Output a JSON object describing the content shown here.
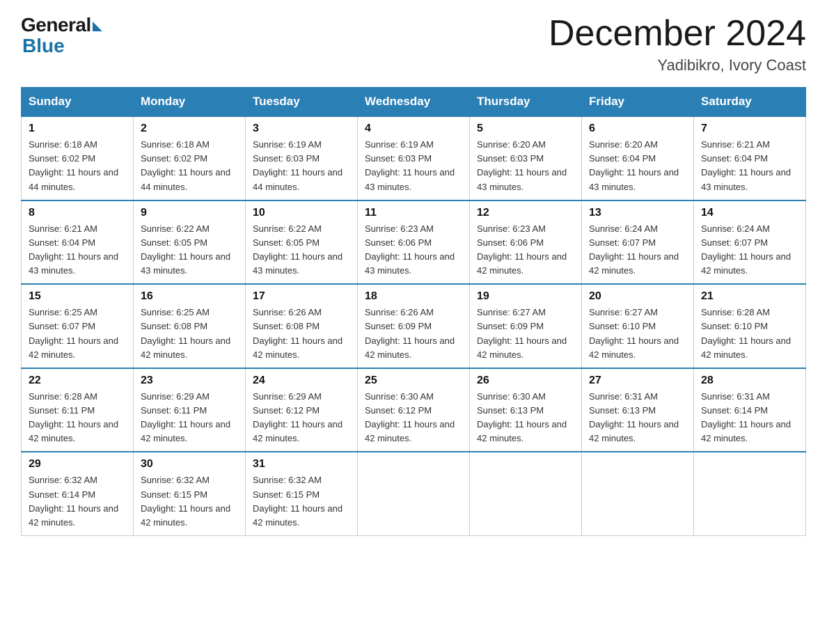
{
  "logo": {
    "general": "General",
    "blue": "Blue"
  },
  "title": "December 2024",
  "location": "Yadibikro, Ivory Coast",
  "days_of_week": [
    "Sunday",
    "Monday",
    "Tuesday",
    "Wednesday",
    "Thursday",
    "Friday",
    "Saturday"
  ],
  "weeks": [
    [
      {
        "day": "1",
        "sunrise": "6:18 AM",
        "sunset": "6:02 PM",
        "daylight": "11 hours and 44 minutes."
      },
      {
        "day": "2",
        "sunrise": "6:18 AM",
        "sunset": "6:02 PM",
        "daylight": "11 hours and 44 minutes."
      },
      {
        "day": "3",
        "sunrise": "6:19 AM",
        "sunset": "6:03 PM",
        "daylight": "11 hours and 44 minutes."
      },
      {
        "day": "4",
        "sunrise": "6:19 AM",
        "sunset": "6:03 PM",
        "daylight": "11 hours and 43 minutes."
      },
      {
        "day": "5",
        "sunrise": "6:20 AM",
        "sunset": "6:03 PM",
        "daylight": "11 hours and 43 minutes."
      },
      {
        "day": "6",
        "sunrise": "6:20 AM",
        "sunset": "6:04 PM",
        "daylight": "11 hours and 43 minutes."
      },
      {
        "day": "7",
        "sunrise": "6:21 AM",
        "sunset": "6:04 PM",
        "daylight": "11 hours and 43 minutes."
      }
    ],
    [
      {
        "day": "8",
        "sunrise": "6:21 AM",
        "sunset": "6:04 PM",
        "daylight": "11 hours and 43 minutes."
      },
      {
        "day": "9",
        "sunrise": "6:22 AM",
        "sunset": "6:05 PM",
        "daylight": "11 hours and 43 minutes."
      },
      {
        "day": "10",
        "sunrise": "6:22 AM",
        "sunset": "6:05 PM",
        "daylight": "11 hours and 43 minutes."
      },
      {
        "day": "11",
        "sunrise": "6:23 AM",
        "sunset": "6:06 PM",
        "daylight": "11 hours and 43 minutes."
      },
      {
        "day": "12",
        "sunrise": "6:23 AM",
        "sunset": "6:06 PM",
        "daylight": "11 hours and 42 minutes."
      },
      {
        "day": "13",
        "sunrise": "6:24 AM",
        "sunset": "6:07 PM",
        "daylight": "11 hours and 42 minutes."
      },
      {
        "day": "14",
        "sunrise": "6:24 AM",
        "sunset": "6:07 PM",
        "daylight": "11 hours and 42 minutes."
      }
    ],
    [
      {
        "day": "15",
        "sunrise": "6:25 AM",
        "sunset": "6:07 PM",
        "daylight": "11 hours and 42 minutes."
      },
      {
        "day": "16",
        "sunrise": "6:25 AM",
        "sunset": "6:08 PM",
        "daylight": "11 hours and 42 minutes."
      },
      {
        "day": "17",
        "sunrise": "6:26 AM",
        "sunset": "6:08 PM",
        "daylight": "11 hours and 42 minutes."
      },
      {
        "day": "18",
        "sunrise": "6:26 AM",
        "sunset": "6:09 PM",
        "daylight": "11 hours and 42 minutes."
      },
      {
        "day": "19",
        "sunrise": "6:27 AM",
        "sunset": "6:09 PM",
        "daylight": "11 hours and 42 minutes."
      },
      {
        "day": "20",
        "sunrise": "6:27 AM",
        "sunset": "6:10 PM",
        "daylight": "11 hours and 42 minutes."
      },
      {
        "day": "21",
        "sunrise": "6:28 AM",
        "sunset": "6:10 PM",
        "daylight": "11 hours and 42 minutes."
      }
    ],
    [
      {
        "day": "22",
        "sunrise": "6:28 AM",
        "sunset": "6:11 PM",
        "daylight": "11 hours and 42 minutes."
      },
      {
        "day": "23",
        "sunrise": "6:29 AM",
        "sunset": "6:11 PM",
        "daylight": "11 hours and 42 minutes."
      },
      {
        "day": "24",
        "sunrise": "6:29 AM",
        "sunset": "6:12 PM",
        "daylight": "11 hours and 42 minutes."
      },
      {
        "day": "25",
        "sunrise": "6:30 AM",
        "sunset": "6:12 PM",
        "daylight": "11 hours and 42 minutes."
      },
      {
        "day": "26",
        "sunrise": "6:30 AM",
        "sunset": "6:13 PM",
        "daylight": "11 hours and 42 minutes."
      },
      {
        "day": "27",
        "sunrise": "6:31 AM",
        "sunset": "6:13 PM",
        "daylight": "11 hours and 42 minutes."
      },
      {
        "day": "28",
        "sunrise": "6:31 AM",
        "sunset": "6:14 PM",
        "daylight": "11 hours and 42 minutes."
      }
    ],
    [
      {
        "day": "29",
        "sunrise": "6:32 AM",
        "sunset": "6:14 PM",
        "daylight": "11 hours and 42 minutes."
      },
      {
        "day": "30",
        "sunrise": "6:32 AM",
        "sunset": "6:15 PM",
        "daylight": "11 hours and 42 minutes."
      },
      {
        "day": "31",
        "sunrise": "6:32 AM",
        "sunset": "6:15 PM",
        "daylight": "11 hours and 42 minutes."
      },
      null,
      null,
      null,
      null
    ]
  ]
}
